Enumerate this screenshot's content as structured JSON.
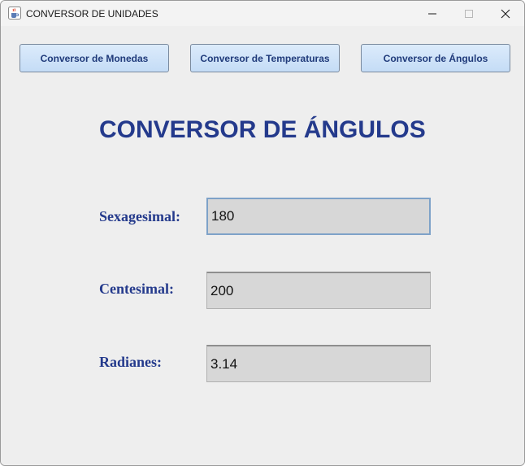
{
  "window": {
    "title": "CONVERSOR DE UNIDADES"
  },
  "nav": {
    "monedas_label": "Conversor de Monedas",
    "temperaturas_label": "Conversor de Temperaturas",
    "angulos_label": "Conversor de Ángulos"
  },
  "main": {
    "title": "CONVERSOR DE ÁNGULOS",
    "fields": [
      {
        "label": "Sexagesimal:",
        "value": "180"
      },
      {
        "label": "Centesimal:",
        "value": "200"
      },
      {
        "label": "Radianes:",
        "value": "3.14"
      }
    ]
  },
  "colors": {
    "accent": "#243a8c",
    "button_bg": "#c4dcf6",
    "field_bg": "#d7d7d7",
    "window_bg": "#eeeeee"
  },
  "icons": {
    "app": "java-cup-icon",
    "minimize": "minimize-icon",
    "maximize": "maximize-icon",
    "close": "close-icon"
  }
}
